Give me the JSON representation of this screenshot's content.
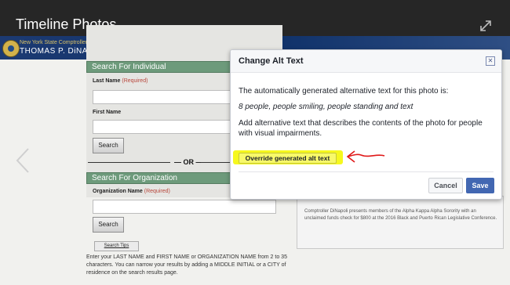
{
  "viewer": {
    "title": "Timeline Photos",
    "expand_icon": "expand-icon",
    "prev_icon": "chevron-left-icon"
  },
  "photo": {
    "banner_line1": "New York State Comptroller",
    "banner_line2": "THOMAS P. DiNAPOLI",
    "section_individual": "Search For Individual",
    "last_name_label": "Last Name",
    "required_tag": "(Required)",
    "first_name_label": "First Name",
    "search_button": "Search",
    "or_divider": "OR",
    "section_organization": "Search For Organization",
    "org_name_label": "Organization Name",
    "search_tips": "Search Tips",
    "instructions": "Enter your LAST NAME and FIRST NAME or ORGANIZATION NAME from 2 to 35 characters. You can narrow your results by adding a MIDDLE INITIAL or a CITY of residence on the search results page.",
    "news_caption": "Comptroller DiNapoli presents members of the Alpha Kappa Alpha Sorority with an unclaimed funds check for $800 at the 2016 Black and Puerto Rican Legislative Conference."
  },
  "modal": {
    "title": "Change Alt Text",
    "close_icon": "close-icon",
    "intro": "The automatically generated alternative text for this photo is:",
    "generated_alt": "8 people, people smiling, people standing and text",
    "instruction": "Add alternative text that describes the contents of the photo for people with visual impairments.",
    "override_label": "Override generated alt text",
    "cancel_label": "Cancel",
    "save_label": "Save"
  },
  "colors": {
    "highlight": "#f6f81e",
    "annotation_arrow": "#e01818",
    "save_button": "#4267b2",
    "section_header": "#6d9a7b"
  }
}
